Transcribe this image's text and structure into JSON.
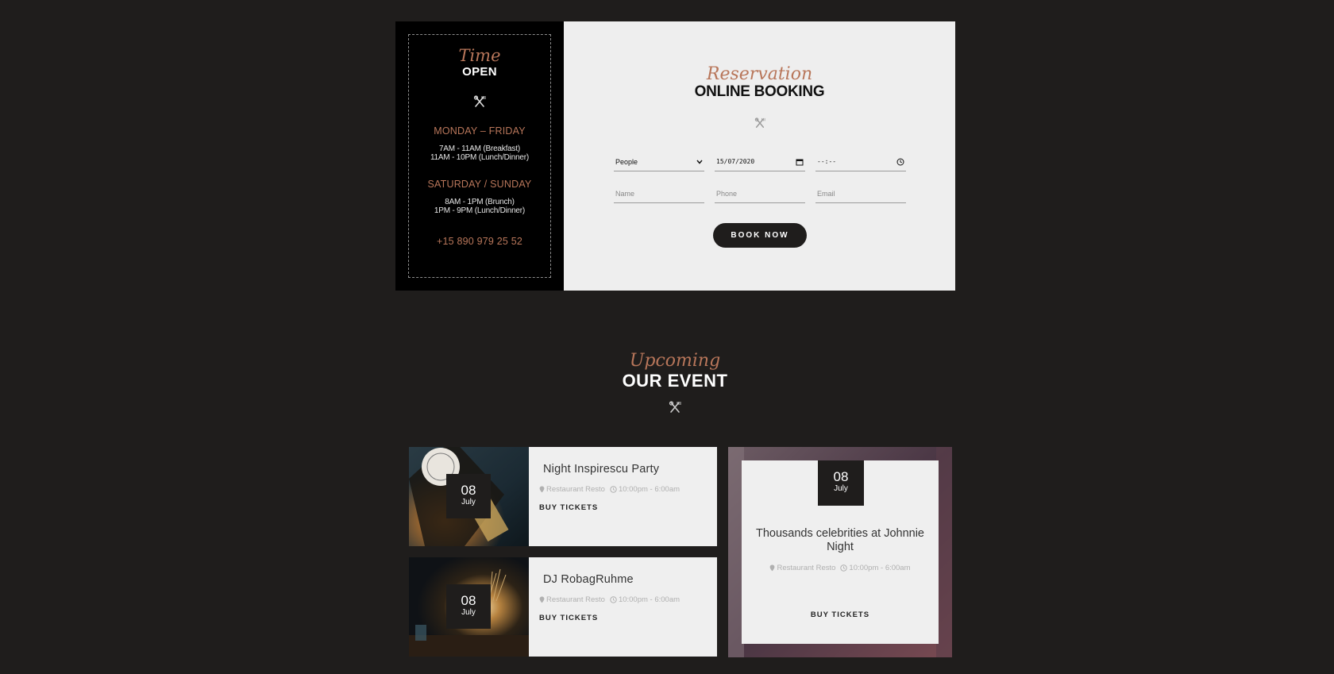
{
  "hours": {
    "script": "Time",
    "title": "OPEN",
    "weekday_title": "MONDAY – FRIDAY",
    "weekday_line1": "7AM - 11AM (Breakfast)",
    "weekday_line2": "11AM - 10PM (Lunch/Dinner)",
    "weekend_title": "SATURDAY / SUNDAY",
    "weekend_line1": "8AM - 1PM (Brunch)",
    "weekend_line2": "1PM - 9PM (Lunch/Dinner)",
    "phone": "+15 890 979 25 52"
  },
  "booking": {
    "script": "Reservation",
    "title": "ONLINE BOOKING",
    "people": "People",
    "date": "15/07/2020",
    "time": "--:--",
    "name_placeholder": "Name",
    "phone_placeholder": "Phone",
    "email_placeholder": "Email",
    "button": "BOOK NOW"
  },
  "events": {
    "script": "Upcoming",
    "title": "OUR EVENT",
    "items": [
      {
        "day": "08",
        "month": "July",
        "title": "Night Inspirescu Party",
        "place": "Restaurant Resto",
        "time": "10:00pm - 6:00am",
        "buy": "BUY TICKETS"
      },
      {
        "day": "08",
        "month": "July",
        "title": "DJ RobagRuhme",
        "place": "Restaurant Resto",
        "time": "10:00pm - 6:00am",
        "buy": "BUY TICKETS"
      },
      {
        "day": "08",
        "month": "July",
        "title": "Thousands celebrities at Johnnie Night",
        "place": "Restaurant Resto",
        "time": "10:00pm - 6:00am",
        "buy": "BUY TICKETS"
      }
    ]
  },
  "colors": {
    "page_bg": "#1f1d1c",
    "accent": "#b8765a",
    "panel_light": "#eeeeee"
  }
}
